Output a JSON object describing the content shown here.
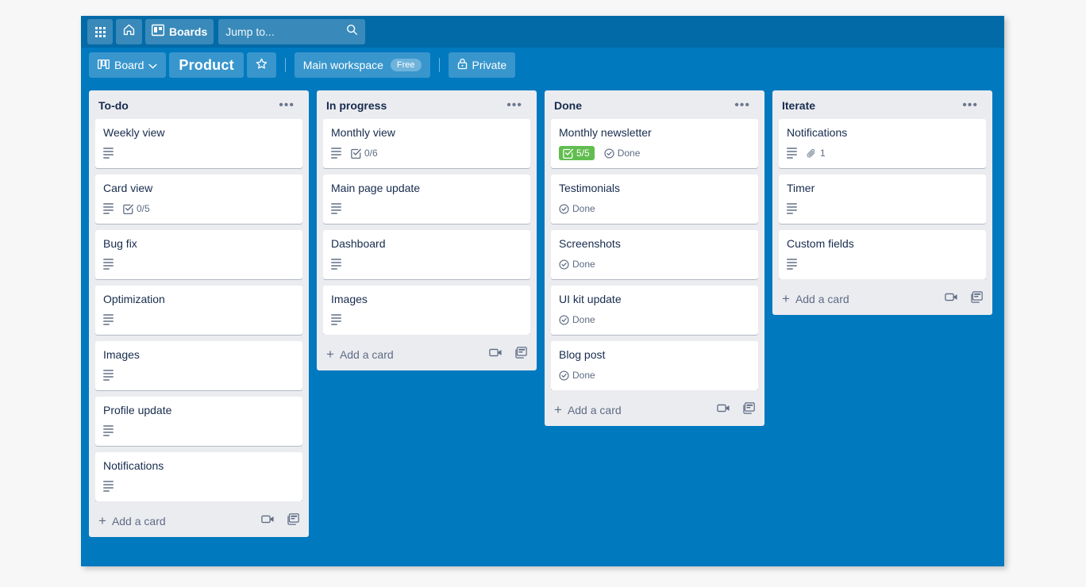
{
  "colors": {
    "top_nav": "#026aa7",
    "board_bg": "#0079bf",
    "list_bg": "#ebecf0",
    "card_bg": "#ffffff",
    "complete_green": "#61bd4f",
    "text_dark": "#172b4d",
    "text_muted": "#5e6c84",
    "page_bg": "#f7f7f7"
  },
  "top_nav": {
    "apps_icon": "grid-apps-icon",
    "home_icon": "home-icon",
    "boards_icon": "boards-icon",
    "boards_label": "Boards",
    "search_placeholder": "Jump to...",
    "search_value": "",
    "search_icon": "search-icon"
  },
  "board_header": {
    "view_icon": "board-view-icon",
    "view_label": "Board",
    "view_chevron": "chevron-down-icon",
    "title": "Product",
    "star_icon": "star-icon",
    "workspace_label": "Main workspace",
    "plan_badge": "Free",
    "visibility_icon": "lock-icon",
    "visibility_label": "Private"
  },
  "lists": [
    {
      "title": "To-do",
      "menu_icon": "list-menu-icon",
      "add_card_label": "Add a card",
      "add_card_plus_icon": "plus-icon",
      "template_icon": "card-template-icon",
      "video_icon": "video-camera-icon",
      "cards": [
        {
          "title": "Weekly view",
          "badges": [
            {
              "type": "description",
              "icon": "description-icon"
            }
          ]
        },
        {
          "title": "Card view",
          "badges": [
            {
              "type": "description",
              "icon": "description-icon"
            },
            {
              "type": "checklist",
              "icon": "checklist-icon",
              "text": "0/5",
              "complete": false
            }
          ]
        },
        {
          "title": "Bug fix",
          "badges": [
            {
              "type": "description",
              "icon": "description-icon"
            }
          ]
        },
        {
          "title": "Optimization",
          "badges": [
            {
              "type": "description",
              "icon": "description-icon"
            }
          ]
        },
        {
          "title": "Images",
          "badges": [
            {
              "type": "description",
              "icon": "description-icon"
            }
          ]
        },
        {
          "title": "Profile update",
          "badges": [
            {
              "type": "description",
              "icon": "description-icon"
            }
          ]
        },
        {
          "title": "Notifications",
          "badges": [
            {
              "type": "description",
              "icon": "description-icon"
            }
          ]
        }
      ]
    },
    {
      "title": "In progress",
      "menu_icon": "list-menu-icon",
      "add_card_label": "Add a card",
      "add_card_plus_icon": "plus-icon",
      "template_icon": "card-template-icon",
      "video_icon": "video-camera-icon",
      "cards": [
        {
          "title": "Monthly view",
          "badges": [
            {
              "type": "description",
              "icon": "description-icon"
            },
            {
              "type": "checklist",
              "icon": "checklist-icon",
              "text": "0/6",
              "complete": false
            }
          ]
        },
        {
          "title": "Main page update",
          "badges": [
            {
              "type": "description",
              "icon": "description-icon"
            }
          ]
        },
        {
          "title": "Dashboard",
          "badges": [
            {
              "type": "description",
              "icon": "description-icon"
            }
          ]
        },
        {
          "title": "Images",
          "badges": [
            {
              "type": "description",
              "icon": "description-icon"
            }
          ]
        }
      ]
    },
    {
      "title": "Done",
      "menu_icon": "list-menu-icon",
      "add_card_label": "Add a card",
      "add_card_plus_icon": "plus-icon",
      "template_icon": "card-template-icon",
      "video_icon": "video-camera-icon",
      "cards": [
        {
          "title": "Monthly newsletter",
          "badges": [
            {
              "type": "checklist",
              "icon": "checklist-icon",
              "text": "5/5",
              "complete": true
            },
            {
              "type": "duedate",
              "icon": "clock-check-icon",
              "text": "Done"
            }
          ]
        },
        {
          "title": "Testimonials",
          "badges": [
            {
              "type": "duedate",
              "icon": "clock-check-icon",
              "text": "Done"
            }
          ]
        },
        {
          "title": "Screenshots",
          "badges": [
            {
              "type": "duedate",
              "icon": "clock-check-icon",
              "text": "Done"
            }
          ]
        },
        {
          "title": "UI kit update",
          "badges": [
            {
              "type": "duedate",
              "icon": "clock-check-icon",
              "text": "Done"
            }
          ]
        },
        {
          "title": "Blog post",
          "badges": [
            {
              "type": "duedate",
              "icon": "clock-check-icon",
              "text": "Done"
            }
          ]
        }
      ]
    },
    {
      "title": "Iterate",
      "menu_icon": "list-menu-icon",
      "add_card_label": "Add a card",
      "add_card_plus_icon": "plus-icon",
      "template_icon": "card-template-icon",
      "video_icon": "video-camera-icon",
      "cards": [
        {
          "title": "Notifications",
          "badges": [
            {
              "type": "description",
              "icon": "description-icon"
            },
            {
              "type": "attachment",
              "icon": "paperclip-icon",
              "text": "1"
            }
          ]
        },
        {
          "title": "Timer",
          "badges": [
            {
              "type": "description",
              "icon": "description-icon"
            }
          ]
        },
        {
          "title": "Custom fields",
          "badges": [
            {
              "type": "description",
              "icon": "description-icon"
            }
          ]
        }
      ]
    }
  ]
}
